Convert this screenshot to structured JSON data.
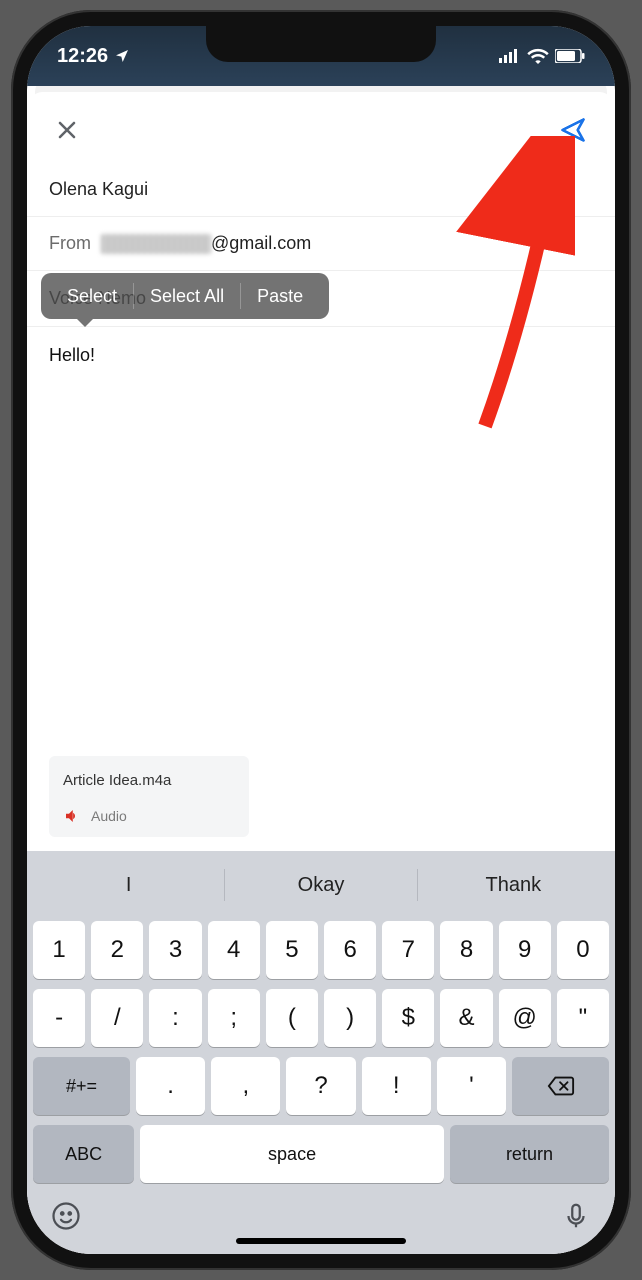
{
  "status": {
    "time": "12:26"
  },
  "compose": {
    "to": "Olena Kagui",
    "from_label": "From",
    "from_domain": "@gmail.com",
    "subject": "Voice Nemo",
    "body": "Hello!"
  },
  "edit_menu": {
    "select": "Select",
    "select_all": "Select All",
    "paste": "Paste"
  },
  "attachment": {
    "name": "Article Idea.m4a",
    "kind": "Audio"
  },
  "keyboard": {
    "predictions": [
      "I",
      "Okay",
      "Thank"
    ],
    "row1": [
      "1",
      "2",
      "3",
      "4",
      "5",
      "6",
      "7",
      "8",
      "9",
      "0"
    ],
    "row2": [
      "-",
      "/",
      ":",
      ";",
      "(",
      ")",
      "$",
      "&",
      "@",
      "\""
    ],
    "row3_shift": "#+=",
    "row3": [
      ".",
      ",",
      "?",
      "!",
      "'"
    ],
    "abc": "ABC",
    "space": "space",
    "return": "return"
  }
}
